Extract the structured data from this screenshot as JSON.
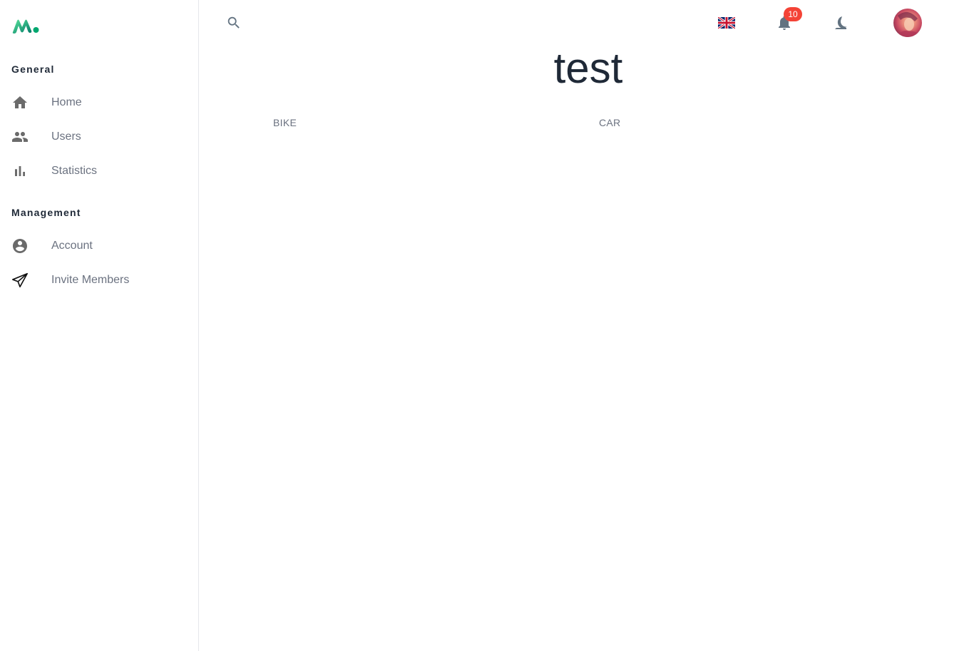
{
  "sidebar": {
    "logo_icon": "m-logo-icon",
    "sections": [
      {
        "title": "General",
        "items": [
          {
            "label": "Home",
            "icon": "home-icon"
          },
          {
            "label": "Users",
            "icon": "users-icon"
          },
          {
            "label": "Statistics",
            "icon": "bar-chart-icon"
          }
        ]
      },
      {
        "title": "Management",
        "items": [
          {
            "label": "Account",
            "icon": "account-circle-icon"
          },
          {
            "label": "Invite Members",
            "icon": "send-icon"
          }
        ]
      }
    ]
  },
  "header": {
    "search_icon": "search-icon",
    "language_icon": "uk-flag-icon",
    "notifications": {
      "icon": "bell-icon",
      "count": "10"
    },
    "theme_icon": "moon-icon",
    "avatar_icon": "user-avatar"
  },
  "main": {
    "title": "test",
    "tabs": [
      {
        "label": "BIKE"
      },
      {
        "label": "CAR"
      }
    ]
  },
  "colors": {
    "brand_green": "#00a76f",
    "badge_red": "#f44336",
    "text_primary": "#1f2937",
    "text_secondary": "#6b7280"
  }
}
